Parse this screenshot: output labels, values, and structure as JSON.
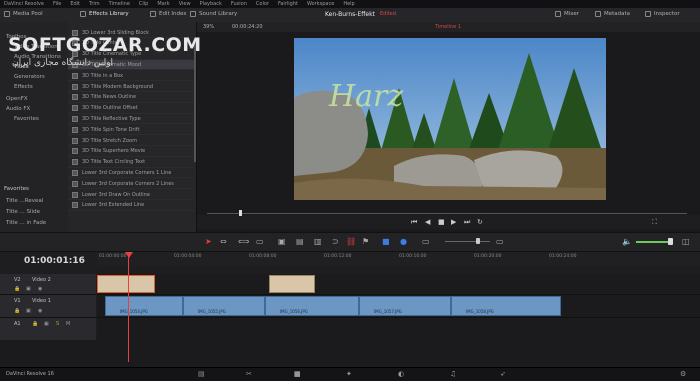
{
  "menubar": [
    "DaVinci Resolve",
    "File",
    "Edit",
    "Trim",
    "Timeline",
    "Clip",
    "Mark",
    "View",
    "Playback",
    "Fusion",
    "Color",
    "Fairlight",
    "Workspace",
    "Help"
  ],
  "toolbar": {
    "media_pool": "Media Pool",
    "effects_library": "Effects Library",
    "edit_index": "Edit Index",
    "sound_library": "Sound Library",
    "project_title": "Ken-Burns-Effekt",
    "project_status": "Edited",
    "mixer": "Mixer",
    "metadata": "Metadata",
    "inspector": "Inspector"
  },
  "viewer": {
    "zoom": "39%",
    "timecode": "00:00:24:20",
    "timeline_name": "Timeline 1",
    "title_text": "Harz"
  },
  "sidebar": {
    "items": [
      "Toolbox",
      "Video Transitions",
      "Audio Transitions",
      "Titles",
      "Generators",
      "Effects",
      "OpenFX",
      "Audio FX",
      "Favorites"
    ],
    "favorites_header": "Favorites",
    "favorites": [
      "Title ...Reveal",
      "Title ... Slide",
      "Title ... in Fade"
    ]
  },
  "effects": [
    "3D Lower 3rd Sliding Block",
    "3D Title Center",
    "3D Title Cinematic Type",
    "3D Title Dramatic Mood",
    "3D Title in a Box",
    "3D Title Modern Background",
    "3D Title News Outline",
    "3D Title Outline Offset",
    "3D Title Reflective Type",
    "3D Title Spin Tone Drift",
    "3D Title Stretch Zoom",
    "3D Title Superhero Movie",
    "3D Title Text Circling Text",
    "Lower 3rd Corporate Corners 1 Line",
    "Lower 3rd Corporate Corners 2 Lines",
    "Lower 3rd Draw On Outline",
    "Lower 3rd Extended Line"
  ],
  "timeline": {
    "timecode": "01:00:01:16",
    "ruler_labels": [
      "01:00:00:00",
      "01:00:04:00",
      "01:00:08:00",
      "01:00:12:00",
      "01:00:16:00",
      "01:00:20:00",
      "01:00:24:00"
    ],
    "tracks": [
      {
        "id": "V2",
        "name": "Video 2"
      },
      {
        "id": "V1",
        "name": "Video 1"
      },
      {
        "id": "A1",
        "name": ""
      }
    ],
    "v1_clips": [
      "IMG_1054.JPG",
      "IMG_1055.JPG",
      "IMG_1056.JPG",
      "IMG_1057.JPG",
      "IMG_1058.JPG"
    ]
  },
  "footer": {
    "app_name": "DaVinci Resolve 16"
  },
  "watermark": {
    "line1": "SOFTGOZAR.COM",
    "line2": "اولین دانشگاه مجازی ایران"
  }
}
